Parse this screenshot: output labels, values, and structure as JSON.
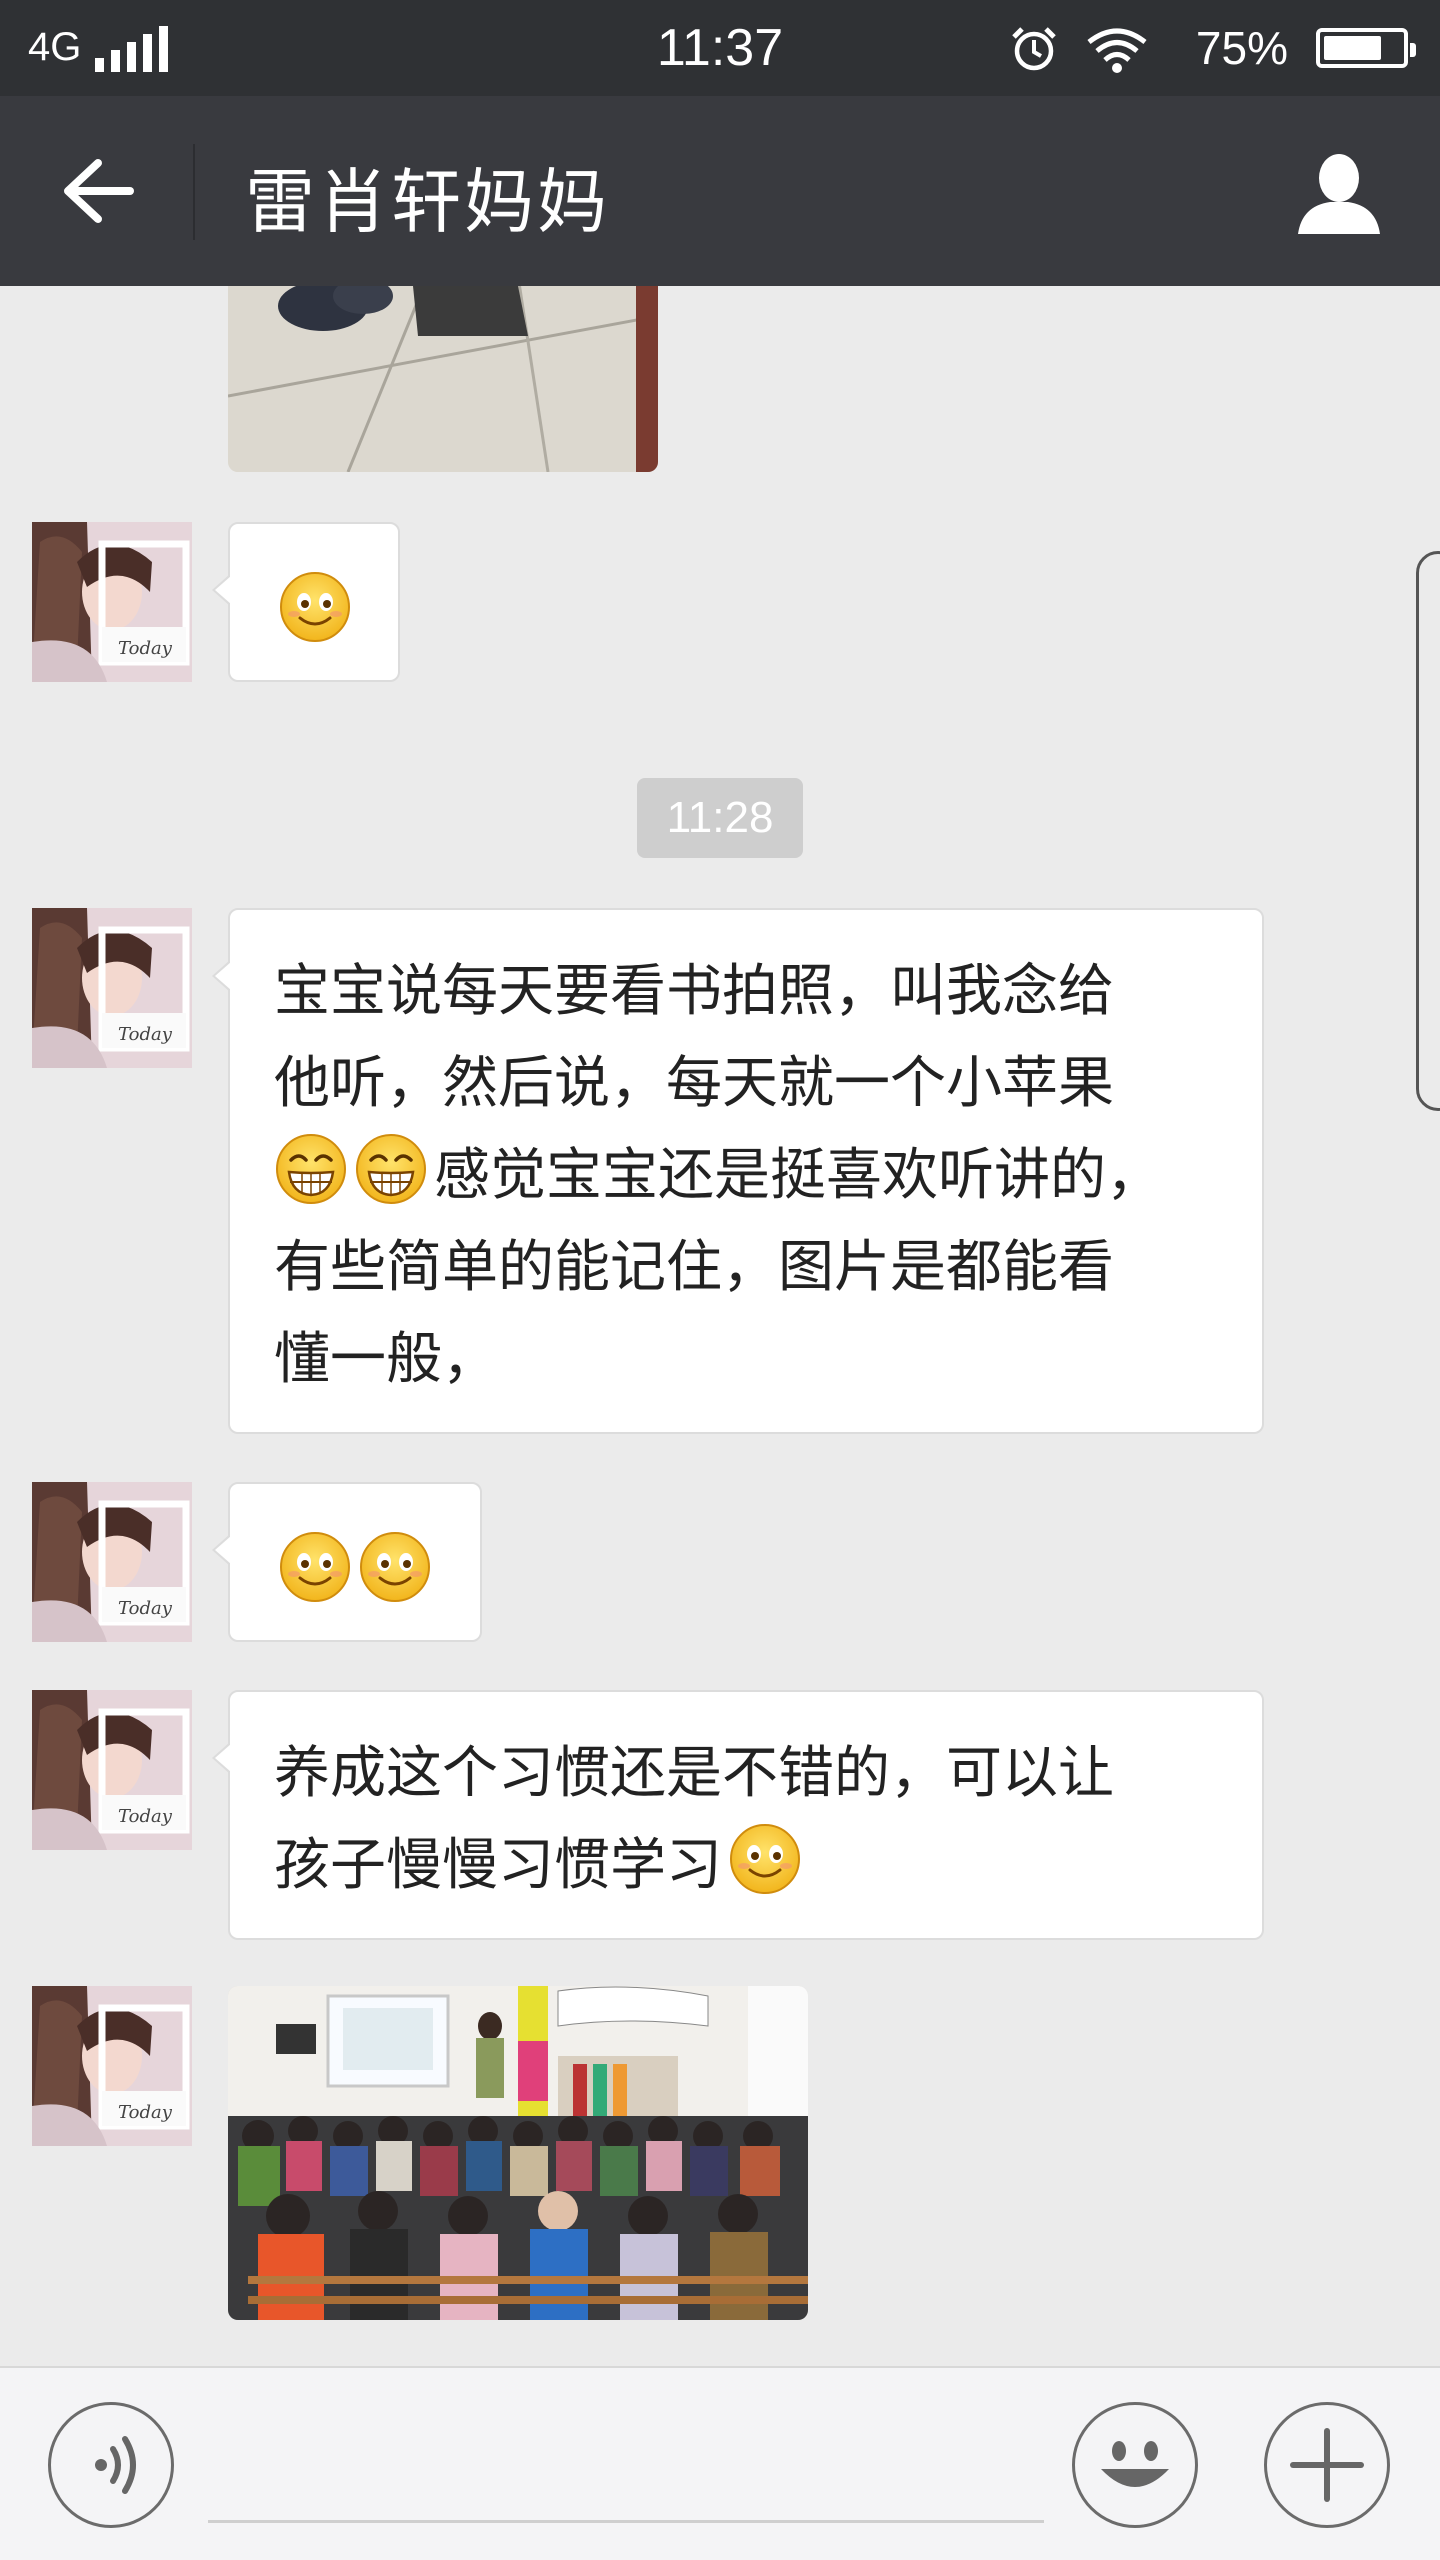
{
  "status_bar": {
    "network": "4G",
    "time": "11:37",
    "battery_percent": "75%",
    "battery_level": 0.75,
    "icons": [
      "signal-icon",
      "alarm-icon",
      "wifi-icon",
      "battery-icon"
    ]
  },
  "header": {
    "title": "雷肖轩妈妈",
    "back_icon": "back-arrow-icon",
    "profile_icon": "person-icon"
  },
  "messages": [
    {
      "type": "image",
      "description_icon": "photo-thumbnail"
    },
    {
      "type": "emoji",
      "emojis": [
        "smile-emoji"
      ]
    },
    {
      "type": "timestamp",
      "text": "11:28"
    },
    {
      "type": "text",
      "lines": [
        "宝宝说每天要看书拍照，叫我念给",
        "他听，然后说，每天就一个小苹果",
        "感觉宝宝还是挺喜欢听讲的，",
        "有些简单的能记住，图片是都能看",
        "懂一般，"
      ],
      "inline_emojis_line3": [
        "grin-emoji",
        "grin-emoji"
      ]
    },
    {
      "type": "emoji",
      "emojis": [
        "smile-emoji",
        "smile-emoji"
      ]
    },
    {
      "type": "text",
      "lines": [
        "养成这个习惯还是不错的，可以让",
        "孩子慢慢习惯学习"
      ],
      "trailing_emoji": "smile-emoji"
    },
    {
      "type": "image",
      "description_icon": "classroom-photo"
    }
  ],
  "input_bar": {
    "voice_icon": "voice-icon",
    "emoji_icon": "emoji-face-icon",
    "plus_icon": "plus-icon",
    "text_value": ""
  },
  "colors": {
    "status_bg": "#2f3134",
    "header_bg": "#393a3f",
    "chat_bg": "#ebebeb",
    "bubble_bg": "#ffffff",
    "timestamp_bg": "#cecece"
  }
}
